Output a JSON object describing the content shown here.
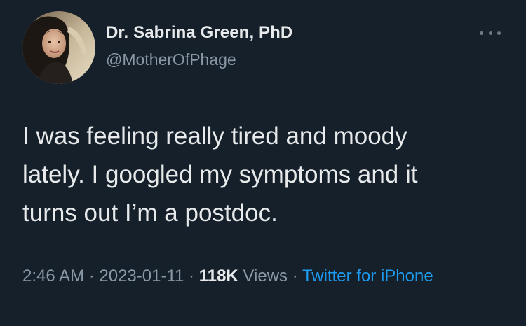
{
  "author": {
    "name": "Dr. Sabrina Green, PhD",
    "handle": "@MotherOfPhage"
  },
  "tweet": {
    "text": "I was feeling really tired and moody\nlately. I googled my symptoms and it\nturns out I’m a postdoc."
  },
  "meta": {
    "time": "2:46 AM",
    "sep1": " · ",
    "date": "2023-01-11",
    "sep2": " · ",
    "views_count": "118K",
    "views_label": " Views",
    "sep3": " · ",
    "source": "Twitter for iPhone"
  },
  "icons": {
    "more": "more-options-icon"
  },
  "colors": {
    "background": "#15202b",
    "text": "#e7e9ea",
    "secondary": "#8b98a5",
    "link": "#1d9bf0"
  }
}
